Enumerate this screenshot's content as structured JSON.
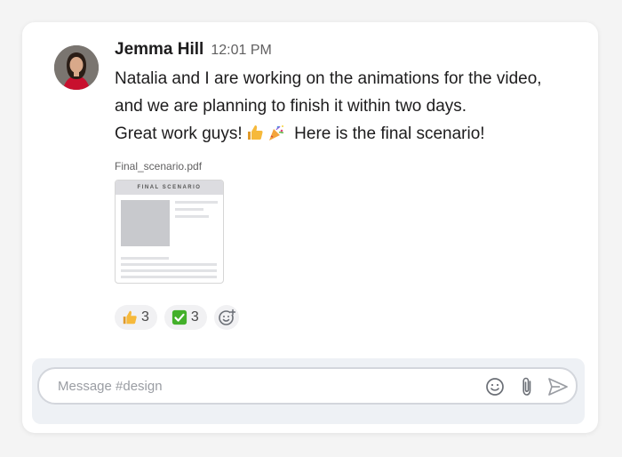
{
  "message": {
    "author": "Jemma Hill",
    "time": "12:01 PM",
    "lines": [
      "Natalia and I are working on the animations for the video,",
      "and we are planning to finish it within two days.",
      "Great work guys!"
    ],
    "line3_suffix": "Here is the final scenario!",
    "inline_emojis": [
      "thumbs-up",
      "party-popper"
    ]
  },
  "attachment": {
    "file_name": "Final_scenario.pdf",
    "preview_title": "FINAL SCENARIO"
  },
  "reactions": [
    {
      "emoji": "thumbs-up",
      "count": "3"
    },
    {
      "emoji": "check-mark",
      "count": "3"
    }
  ],
  "composer": {
    "placeholder": "Message #design"
  },
  "colors": {
    "avatar_shirt": "#c8102e",
    "check_green": "#43b02a",
    "thumb_yellow": "#f6b93b",
    "icon_gray": "#7d8188"
  }
}
